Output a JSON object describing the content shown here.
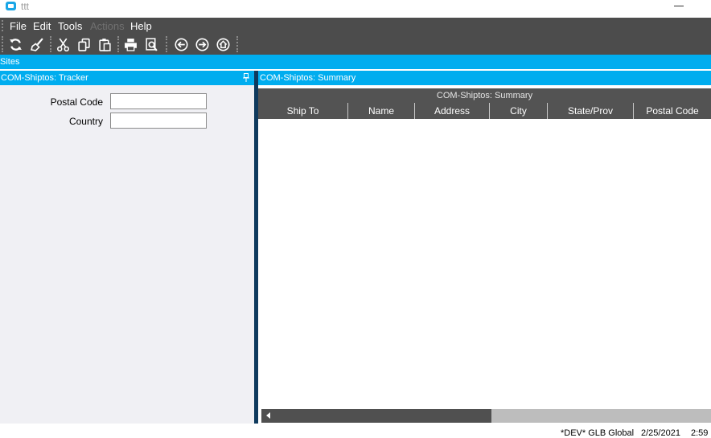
{
  "window": {
    "title": "ttt"
  },
  "menu": {
    "file": "File",
    "edit": "Edit",
    "tools": "Tools",
    "actions": "Actions",
    "help": "Help"
  },
  "toolbar": {
    "icons": [
      "refresh-icon",
      "clear-icon",
      "cut-icon",
      "copy-icon",
      "paste-icon",
      "print-icon",
      "print-preview-icon",
      "back-icon",
      "forward-icon",
      "home-icon"
    ]
  },
  "sites": {
    "label": "Sites"
  },
  "tracker": {
    "title": "COM-Shiptos: Tracker",
    "postal_code_label": "Postal Code",
    "postal_code_value": "",
    "country_label": "Country",
    "country_value": ""
  },
  "summary": {
    "title": "COM-Shiptos: Summary",
    "grid_caption": "COM-Shiptos: Summary",
    "columns": [
      "Ship To",
      "Name",
      "Address",
      "City",
      "State/Prov",
      "Postal Code"
    ],
    "rows": []
  },
  "status": {
    "environment": "*DEV* GLB Global",
    "date": "2/25/2021",
    "time": "2:59"
  },
  "colors": {
    "accent": "#00adef",
    "toolbar": "#4c4c4c",
    "splitter": "#0f3a5e",
    "grid_header": "#535353"
  }
}
